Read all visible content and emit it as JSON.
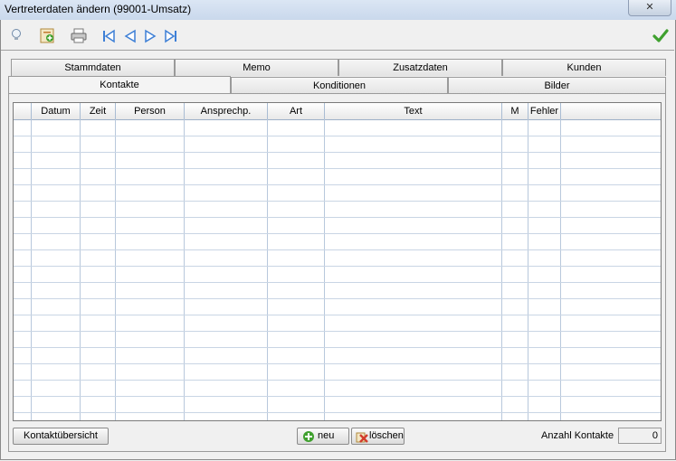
{
  "window": {
    "title": "Vertreterdaten ändern (99001-Umsatz)",
    "close_glyph": "✕"
  },
  "toolbar": {
    "buttons": [
      {
        "name": "lightbulb-icon"
      },
      {
        "name": "add-record-icon"
      },
      {
        "name": "print-icon"
      },
      {
        "name": "first-record-icon"
      },
      {
        "name": "prev-record-icon"
      },
      {
        "name": "next-record-icon"
      },
      {
        "name": "last-record-icon"
      },
      {
        "name": "confirm-checkmark-icon"
      }
    ]
  },
  "tabs": {
    "row1": [
      "Stammdaten",
      "Memo",
      "Zusatzdaten",
      "Kunden"
    ],
    "row2": [
      "Kontakte",
      "Konditionen",
      "Bilder"
    ],
    "active": "Kontakte"
  },
  "grid": {
    "columns": [
      "",
      "Datum",
      "Zeit",
      "Person",
      "Ansprechp.",
      "Art",
      "Text",
      "M",
      "Fehler",
      ""
    ],
    "rows": []
  },
  "footer": {
    "overview_label": "Kontaktübersicht",
    "new_label": "neu",
    "delete_label": "löschen",
    "count_label": "Anzahl Kontakte",
    "count_value": "0"
  },
  "colors": {
    "accent_green": "#3fa02e",
    "nav_blue": "#3d7fd6",
    "delete_red": "#d23b2b"
  }
}
